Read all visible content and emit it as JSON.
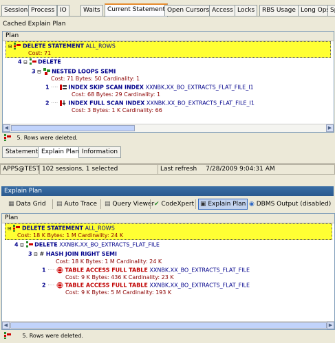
{
  "tabs": [
    "Session",
    "Process",
    "IO",
    "Waits",
    "Current Statement",
    "Open Cursors",
    "Access",
    "Locks",
    "RBS Usage",
    "Long Ops",
    "Sp"
  ],
  "cached_explain_plan_label": "Cached Explain Plan",
  "top_plan": {
    "header": "Plan",
    "rows": [
      {
        "num": "",
        "op": "DELETE STATEMENT",
        "obj": "ALL_ROWS",
        "cost": "Cost: 71"
      },
      {
        "num": "4",
        "op": "DELETE",
        "obj": "",
        "cost": ""
      },
      {
        "num": "3",
        "op": "NESTED LOOPS SEMI",
        "obj": "",
        "cost": "Cost: 71  Bytes: 50  Cardinality: 1"
      },
      {
        "num": "1",
        "op": "INDEX SKIP SCAN INDEX",
        "obj": "XXNBK.XX_BO_EXTRACTS_FLAT_FILE_I1",
        "cost": "Cost: 68  Bytes: 29  Cardinality: 1"
      },
      {
        "num": "2",
        "op": "INDEX FULL SCAN INDEX",
        "obj": "XXNBK.XX_BO_EXTRACTS_FLAT_FILE_I1",
        "cost": "Cost: 3  Bytes: 1 K  Cardinality: 66"
      }
    ],
    "result": "5.  Rows were deleted."
  },
  "subtabs": [
    "Statement",
    "Explain Plan",
    "Information"
  ],
  "status": {
    "user": "APPS@TEST",
    "sessions": "102 sessions, 1 selected",
    "refresh_label": "Last refresh",
    "refresh_time": "7/28/2009 9:04:31 AM"
  },
  "bottom": {
    "title": "Explain Plan",
    "toolbar": [
      "Data Grid",
      "Auto Trace",
      "Query Viewer",
      "CodeXpert",
      "Explain Plan",
      "DBMS Output (disabled)"
    ],
    "header": "Plan",
    "rows": [
      {
        "num": "",
        "op": "DELETE STATEMENT",
        "obj": "ALL_ROWS",
        "cost": "Cost: 18 K  Bytes: 1 M  Cardinality: 24 K"
      },
      {
        "num": "4",
        "op": "DELETE",
        "obj": "XXNBK.XX_BO_EXTRACTS_FLAT_FILE",
        "cost": ""
      },
      {
        "num": "3",
        "op": "HASH JOIN RIGHT SEMI",
        "obj": "",
        "cost": "Cost: 18 K  Bytes: 1 M  Cardinality: 24 K"
      },
      {
        "num": "1",
        "op": "TABLE ACCESS FULL TABLE",
        "obj": "XXNBK.XX_BO_EXTRACTS_FLAT_FILE",
        "cost": "Cost: 9 K  Bytes: 436 K  Cardinality: 23 K"
      },
      {
        "num": "2",
        "op": "TABLE ACCESS FULL TABLE",
        "obj": "XXNBK.XX_BO_EXTRACTS_FLAT_FILE",
        "cost": "Cost: 9 K  Bytes: 5 M  Cardinality: 193 K"
      }
    ],
    "result": "5.  Rows were deleted."
  }
}
